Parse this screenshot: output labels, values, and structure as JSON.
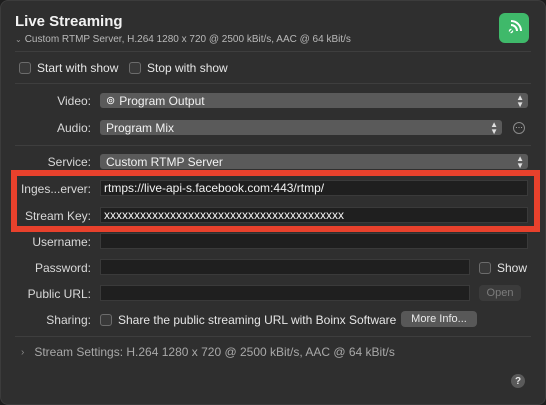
{
  "header": {
    "title": "Live Streaming",
    "subtitle": "Custom RTMP Server, H.264 1280 x 720 @ 2500 kBit/s, AAC @ 64 kBit/s",
    "icon": "broadcast-icon",
    "accent_color": "#3fb96a"
  },
  "options": {
    "start_with_show": "Start with show",
    "stop_with_show": "Stop with show"
  },
  "video": {
    "label": "Video:",
    "value": "Program Output"
  },
  "audio": {
    "label": "Audio:",
    "value": "Program Mix"
  },
  "service": {
    "label": "Service:",
    "value": "Custom RTMP Server"
  },
  "ingest": {
    "label": "Inges...erver:",
    "value": "rtmps://live-api-s.facebook.com:443/rtmp/"
  },
  "stream_key": {
    "label": "Stream Key:",
    "value": "xxxxxxxxxxxxxxxxxxxxxxxxxxxxxxxxxxxxxxxx"
  },
  "username": {
    "label": "Username:",
    "value": ""
  },
  "password": {
    "label": "Password:",
    "value": "",
    "show_label": "Show"
  },
  "public_url": {
    "label": "Public URL:",
    "value": "",
    "open_label": "Open"
  },
  "sharing": {
    "label": "Sharing:",
    "checkbox_label": "Share the public streaming URL with Boinx Software",
    "more_info_label": "More Info..."
  },
  "stream_settings": "Stream Settings: H.264 1280 x 720 @ 2500 kBit/s, AAC @ 64 kBit/s",
  "help_label": "?",
  "highlight_color": "#e8412c"
}
